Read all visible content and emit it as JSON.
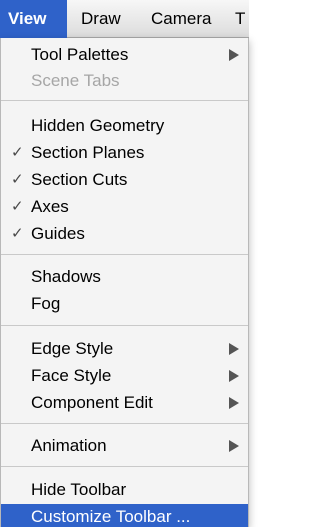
{
  "menubar": {
    "view": "View",
    "draw": "Draw",
    "camera": "Camera",
    "tools": "T"
  },
  "menu": {
    "tool_palettes": "Tool Palettes",
    "scene_tabs": "Scene Tabs",
    "hidden_geometry": "Hidden Geometry",
    "section_planes": "Section Planes",
    "section_cuts": "Section Cuts",
    "axes": "Axes",
    "guides": "Guides",
    "shadows": "Shadows",
    "fog": "Fog",
    "edge_style": "Edge Style",
    "face_style": "Face Style",
    "component_edit": "Component Edit",
    "animation": "Animation",
    "hide_toolbar": "Hide Toolbar",
    "customize_toolbar": "Customize Toolbar ..."
  },
  "checkmark": "✓",
  "colors": {
    "highlight": "#2f62c9",
    "disabled_text": "#a6a6a6",
    "menu_background": "#f4f4f4"
  },
  "icons": {
    "check": "checkmark-icon",
    "submenu": "submenu-arrow-icon"
  }
}
